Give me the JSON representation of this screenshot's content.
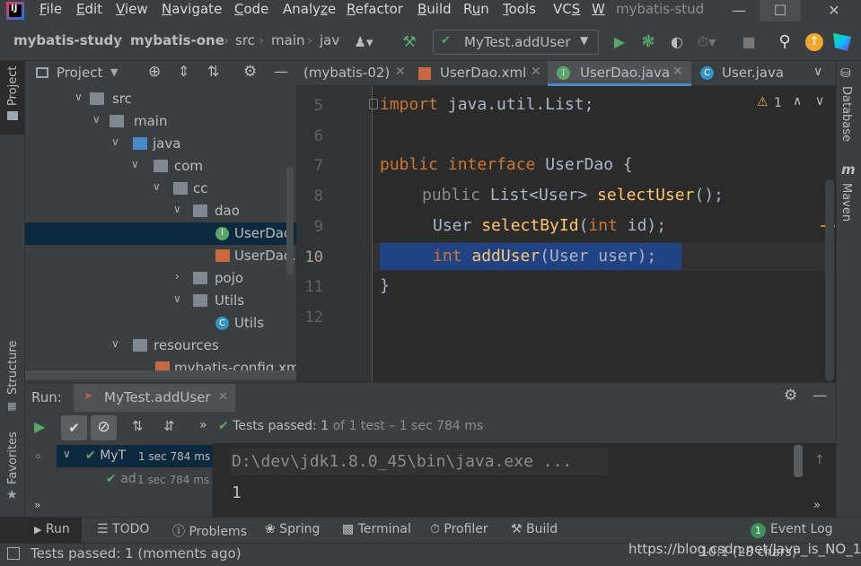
{
  "app": {
    "title": "mybatis-stud",
    "menu": [
      {
        "pre": "",
        "u": "F",
        "post": "ile"
      },
      {
        "pre": "",
        "u": "E",
        "post": "dit"
      },
      {
        "pre": "",
        "u": "V",
        "post": "iew"
      },
      {
        "pre": "",
        "u": "N",
        "post": "avigate"
      },
      {
        "pre": "",
        "u": "C",
        "post": "ode"
      },
      {
        "pre": "Analy",
        "u": "z",
        "post": "e"
      },
      {
        "pre": "",
        "u": "R",
        "post": "efactor"
      },
      {
        "pre": "",
        "u": "B",
        "post": "uild"
      },
      {
        "pre": "R",
        "u": "u",
        "post": "n"
      },
      {
        "pre": "",
        "u": "T",
        "post": "ools"
      },
      {
        "pre": "VC",
        "u": "S",
        "post": ""
      },
      {
        "pre": "",
        "u": "W",
        "post": ""
      }
    ]
  },
  "breadcrumb": [
    "mybatis-study",
    "mybatis-one",
    "src",
    "main",
    "jav"
  ],
  "run_config": "MyTest.addUser",
  "project": {
    "title": "Project",
    "tree": [
      {
        "label": "src",
        "indent": 0
      },
      {
        "label": "main",
        "indent": 1
      },
      {
        "label": "java",
        "indent": 2
      },
      {
        "label": "com",
        "indent": 3
      },
      {
        "label": "cc",
        "indent": 4
      },
      {
        "label": "dao",
        "indent": 5
      },
      {
        "label": "UserDao",
        "indent": 6
      },
      {
        "label": "UserDao.x",
        "indent": 6
      },
      {
        "label": "pojo",
        "indent": 5
      },
      {
        "label": "Utils",
        "indent": 5
      },
      {
        "label": "Utils",
        "indent": 6
      },
      {
        "label": "resources",
        "indent": 2
      },
      {
        "label": "mybatis-config.xm",
        "indent": 3
      }
    ]
  },
  "tabs": [
    "(mybatis-02)",
    "UserDao.xml",
    "UserDao.java",
    "User.java"
  ],
  "editor": {
    "lines": [
      "5",
      "6",
      "7",
      "8",
      "9",
      "10",
      "11",
      "12"
    ],
    "code": {
      "l5_kw": "import",
      "l5_rest": " java.util.List;",
      "l7_kw": "public interface",
      "l7_rest": " UserDao {",
      "l8_kw": "public",
      "l8_a": " List<User> ",
      "l8_fn": "selectUser",
      "l8_b": "();",
      "l9_a": "User ",
      "l9_fn": "selectById",
      "l9_b": "(",
      "l9_kw": "int",
      "l9_c": " id);",
      "l10_kw": "int",
      "l10_a": " ",
      "l10_fn": "addUser",
      "l10_b": "(User user);",
      "l11": "}"
    },
    "warning_count": "1"
  },
  "run": {
    "label": "Run:",
    "config_tab": "MyTest.addUser",
    "status_prefix": "Tests passed:",
    "status_count": "1",
    "status_suffix": "of 1 test – 1 sec 784 ms",
    "tree": [
      {
        "label": "MyT",
        "time": "1 sec 784 ms"
      },
      {
        "label": "ad",
        "time": "1 sec 784 ms"
      }
    ],
    "console": [
      "D:\\dev\\jdk1.8.0_45\\bin\\java.exe ...",
      "1"
    ]
  },
  "side": {
    "left_top": "Project",
    "left_mid": "Structure",
    "left_bot": "Favorites",
    "right_top": "Database",
    "right_mid": "Maven"
  },
  "bottom_tools": [
    "Run",
    "TODO",
    "Problems",
    "Spring",
    "Terminal",
    "Profiler",
    "Build"
  ],
  "event_log": {
    "count": "1",
    "label": "Event Log"
  },
  "status": {
    "message": "Tests passed: 1 (moments ago)",
    "position": "10:1 (28 chars)",
    "watermark": "https://blog.csdn.net/Java_is_NO_1"
  },
  "colors": {
    "accent": "#4a88c7",
    "success": "#59a869",
    "selection": "#214283"
  }
}
